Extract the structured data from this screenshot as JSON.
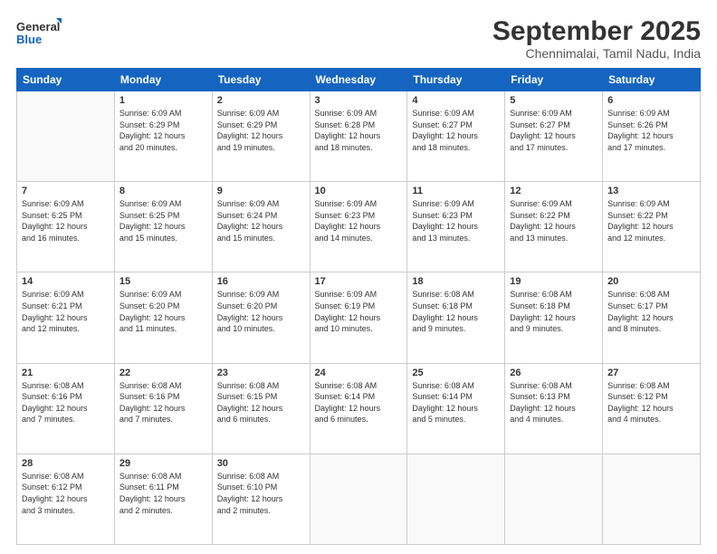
{
  "logo": {
    "line1": "General",
    "line2": "Blue"
  },
  "title": "September 2025",
  "subtitle": "Chennimalai, Tamil Nadu, India",
  "weekdays": [
    "Sunday",
    "Monday",
    "Tuesday",
    "Wednesday",
    "Thursday",
    "Friday",
    "Saturday"
  ],
  "weeks": [
    [
      {
        "day": "",
        "detail": ""
      },
      {
        "day": "1",
        "detail": "Sunrise: 6:09 AM\nSunset: 6:29 PM\nDaylight: 12 hours\nand 20 minutes."
      },
      {
        "day": "2",
        "detail": "Sunrise: 6:09 AM\nSunset: 6:29 PM\nDaylight: 12 hours\nand 19 minutes."
      },
      {
        "day": "3",
        "detail": "Sunrise: 6:09 AM\nSunset: 6:28 PM\nDaylight: 12 hours\nand 18 minutes."
      },
      {
        "day": "4",
        "detail": "Sunrise: 6:09 AM\nSunset: 6:27 PM\nDaylight: 12 hours\nand 18 minutes."
      },
      {
        "day": "5",
        "detail": "Sunrise: 6:09 AM\nSunset: 6:27 PM\nDaylight: 12 hours\nand 17 minutes."
      },
      {
        "day": "6",
        "detail": "Sunrise: 6:09 AM\nSunset: 6:26 PM\nDaylight: 12 hours\nand 17 minutes."
      }
    ],
    [
      {
        "day": "7",
        "detail": "Sunrise: 6:09 AM\nSunset: 6:25 PM\nDaylight: 12 hours\nand 16 minutes."
      },
      {
        "day": "8",
        "detail": "Sunrise: 6:09 AM\nSunset: 6:25 PM\nDaylight: 12 hours\nand 15 minutes."
      },
      {
        "day": "9",
        "detail": "Sunrise: 6:09 AM\nSunset: 6:24 PM\nDaylight: 12 hours\nand 15 minutes."
      },
      {
        "day": "10",
        "detail": "Sunrise: 6:09 AM\nSunset: 6:23 PM\nDaylight: 12 hours\nand 14 minutes."
      },
      {
        "day": "11",
        "detail": "Sunrise: 6:09 AM\nSunset: 6:23 PM\nDaylight: 12 hours\nand 13 minutes."
      },
      {
        "day": "12",
        "detail": "Sunrise: 6:09 AM\nSunset: 6:22 PM\nDaylight: 12 hours\nand 13 minutes."
      },
      {
        "day": "13",
        "detail": "Sunrise: 6:09 AM\nSunset: 6:22 PM\nDaylight: 12 hours\nand 12 minutes."
      }
    ],
    [
      {
        "day": "14",
        "detail": "Sunrise: 6:09 AM\nSunset: 6:21 PM\nDaylight: 12 hours\nand 12 minutes."
      },
      {
        "day": "15",
        "detail": "Sunrise: 6:09 AM\nSunset: 6:20 PM\nDaylight: 12 hours\nand 11 minutes."
      },
      {
        "day": "16",
        "detail": "Sunrise: 6:09 AM\nSunset: 6:20 PM\nDaylight: 12 hours\nand 10 minutes."
      },
      {
        "day": "17",
        "detail": "Sunrise: 6:09 AM\nSunset: 6:19 PM\nDaylight: 12 hours\nand 10 minutes."
      },
      {
        "day": "18",
        "detail": "Sunrise: 6:08 AM\nSunset: 6:18 PM\nDaylight: 12 hours\nand 9 minutes."
      },
      {
        "day": "19",
        "detail": "Sunrise: 6:08 AM\nSunset: 6:18 PM\nDaylight: 12 hours\nand 9 minutes."
      },
      {
        "day": "20",
        "detail": "Sunrise: 6:08 AM\nSunset: 6:17 PM\nDaylight: 12 hours\nand 8 minutes."
      }
    ],
    [
      {
        "day": "21",
        "detail": "Sunrise: 6:08 AM\nSunset: 6:16 PM\nDaylight: 12 hours\nand 7 minutes."
      },
      {
        "day": "22",
        "detail": "Sunrise: 6:08 AM\nSunset: 6:16 PM\nDaylight: 12 hours\nand 7 minutes."
      },
      {
        "day": "23",
        "detail": "Sunrise: 6:08 AM\nSunset: 6:15 PM\nDaylight: 12 hours\nand 6 minutes."
      },
      {
        "day": "24",
        "detail": "Sunrise: 6:08 AM\nSunset: 6:14 PM\nDaylight: 12 hours\nand 6 minutes."
      },
      {
        "day": "25",
        "detail": "Sunrise: 6:08 AM\nSunset: 6:14 PM\nDaylight: 12 hours\nand 5 minutes."
      },
      {
        "day": "26",
        "detail": "Sunrise: 6:08 AM\nSunset: 6:13 PM\nDaylight: 12 hours\nand 4 minutes."
      },
      {
        "day": "27",
        "detail": "Sunrise: 6:08 AM\nSunset: 6:12 PM\nDaylight: 12 hours\nand 4 minutes."
      }
    ],
    [
      {
        "day": "28",
        "detail": "Sunrise: 6:08 AM\nSunset: 6:12 PM\nDaylight: 12 hours\nand 3 minutes."
      },
      {
        "day": "29",
        "detail": "Sunrise: 6:08 AM\nSunset: 6:11 PM\nDaylight: 12 hours\nand 2 minutes."
      },
      {
        "day": "30",
        "detail": "Sunrise: 6:08 AM\nSunset: 6:10 PM\nDaylight: 12 hours\nand 2 minutes."
      },
      {
        "day": "",
        "detail": ""
      },
      {
        "day": "",
        "detail": ""
      },
      {
        "day": "",
        "detail": ""
      },
      {
        "day": "",
        "detail": ""
      }
    ]
  ]
}
